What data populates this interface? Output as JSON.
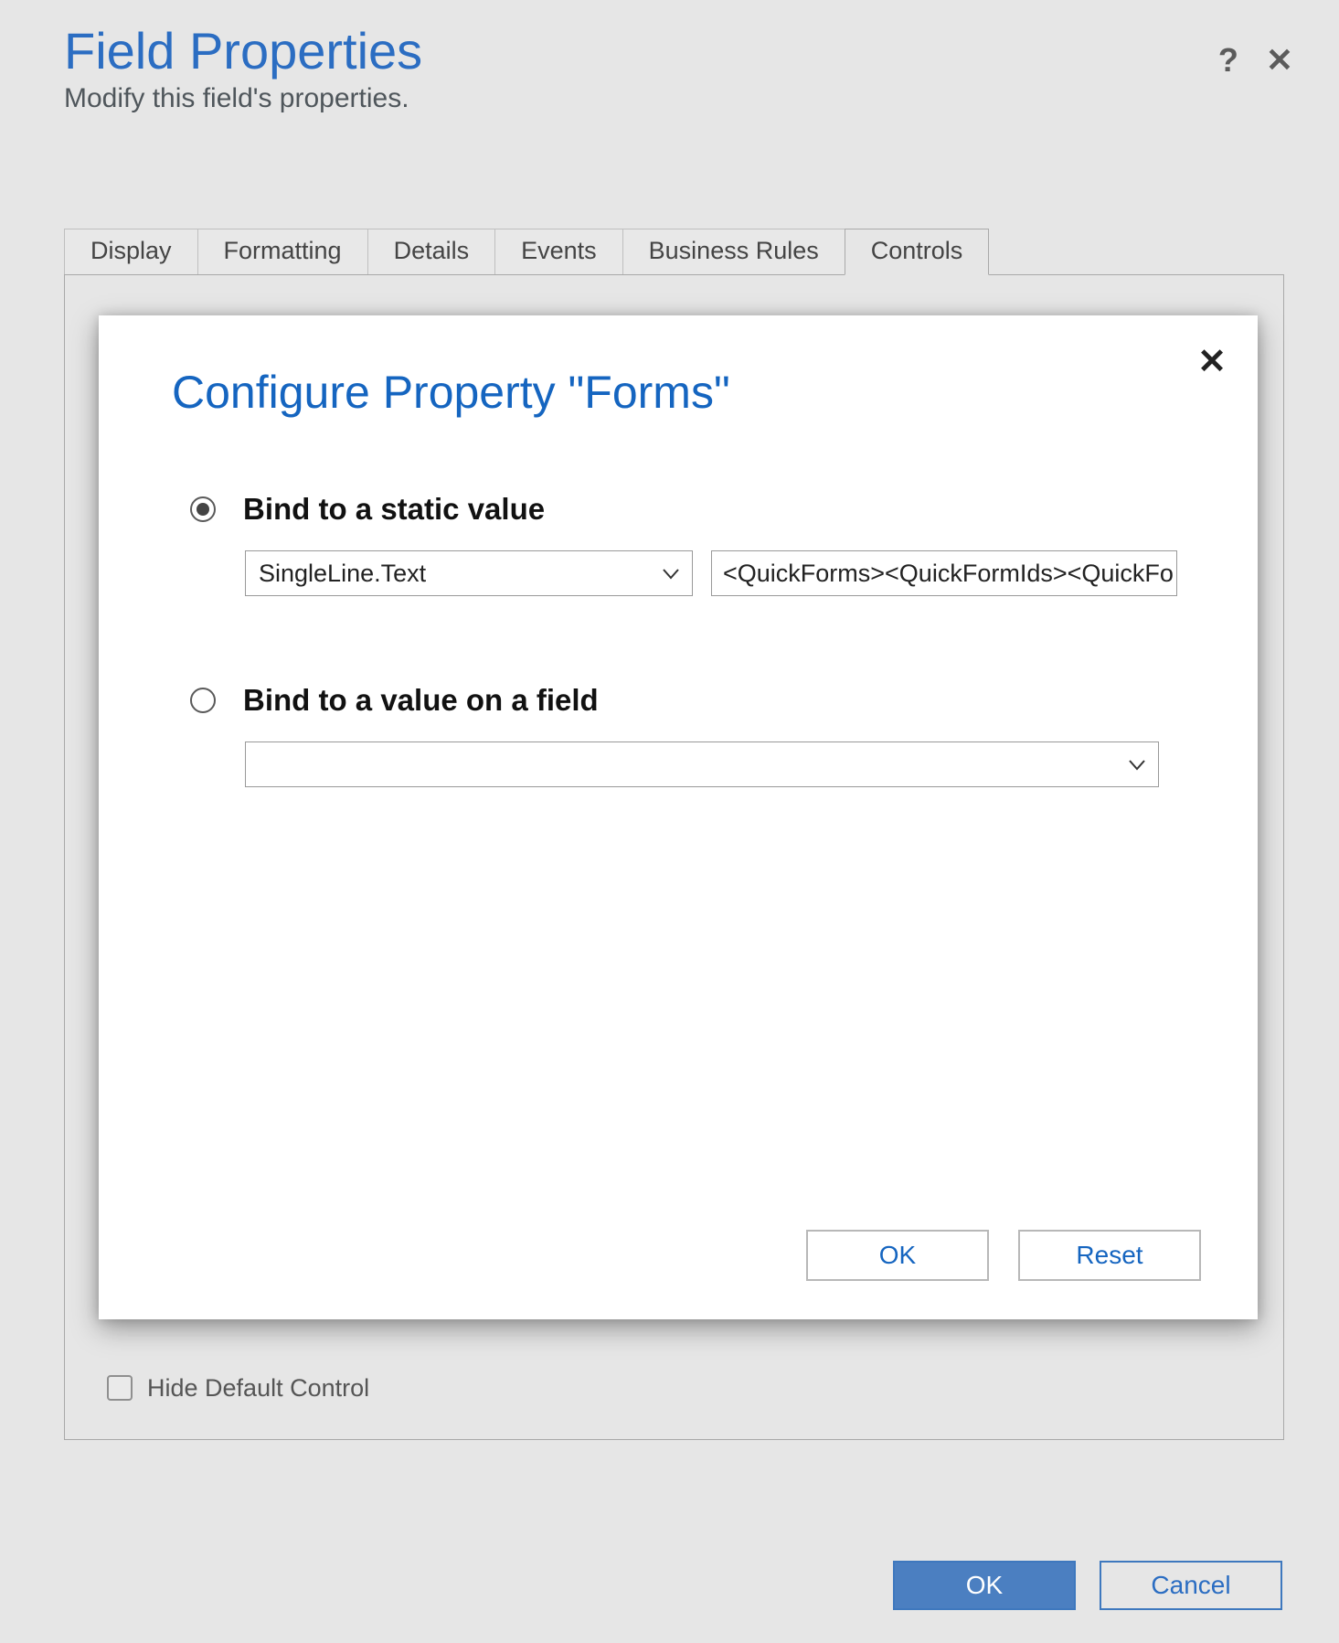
{
  "header": {
    "title": "Field Properties",
    "subtitle": "Modify this field's properties.",
    "help_icon": "?",
    "close_icon": "✕"
  },
  "tabs": {
    "items": [
      {
        "label": "Display"
      },
      {
        "label": "Formatting"
      },
      {
        "label": "Details"
      },
      {
        "label": "Events"
      },
      {
        "label": "Business Rules"
      },
      {
        "label": "Controls"
      }
    ],
    "active_index": 5
  },
  "panel": {
    "hide_default_label": "Hide Default Control"
  },
  "buttons": {
    "ok": "OK",
    "cancel": "Cancel"
  },
  "modal": {
    "title": "Configure Property \"Forms\"",
    "close_icon": "✕",
    "option1": {
      "label": "Bind to a static value",
      "type_value": "SingleLine.Text",
      "text_value": "<QuickForms><QuickFormIds><QuickFo"
    },
    "option2": {
      "label": "Bind to a value on a field",
      "field_value": ""
    },
    "ok": "OK",
    "reset": "Reset"
  }
}
